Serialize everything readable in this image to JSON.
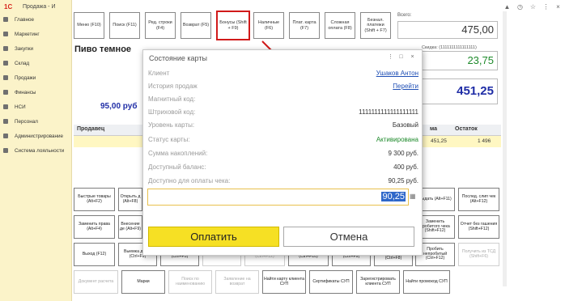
{
  "app": {
    "logo": "1С",
    "title": "Продажа - И"
  },
  "sidebar": {
    "items": [
      {
        "label": "Главное"
      },
      {
        "label": "Маркетинг"
      },
      {
        "label": "Закупки"
      },
      {
        "label": "Склад"
      },
      {
        "label": "Продажи"
      },
      {
        "label": "Финансы"
      },
      {
        "label": "НСИ"
      },
      {
        "label": "Персонал"
      },
      {
        "label": "Администрирование"
      },
      {
        "label": "Система лояльности"
      }
    ]
  },
  "toolbar": {
    "menu": "Меню (F10)",
    "search": "Поиск (F11)",
    "edit_line": "Ред. строки (F4)",
    "return": "Возврат (F5)",
    "bonuses": "Бонусы (Shift + F9)",
    "cash": "Наличные (F6)",
    "card": "Плат. карта (F7)",
    "complex": "Сложная оплата (F8)",
    "cashless": "Безнал. платежи (Shift + F7)"
  },
  "totals": {
    "total_label": "Всего:",
    "total_value": "475,00",
    "discount_label": "Скидка: (1111111111111111)",
    "discount_value": "23,75",
    "to_pay_value": "451,25"
  },
  "product": {
    "name": "Пиво темное",
    "price": "95,00 руб"
  },
  "table": {
    "headers": {
      "seller": "Продавец",
      "sum": "ма",
      "stock": "Остаток"
    },
    "row": {
      "sum": "451,25",
      "stock": "1 496"
    }
  },
  "grid": {
    "row1": [
      "Быстрые товары (Alt+F2)",
      "Открыть д (Alt+F8)",
      "",
      "",
      "",
      "",
      "",
      "",
      "Выдать (Alt+F11)",
      "Послед. слип чек (Alt+F12)"
    ],
    "row2": [
      "Заменить права (Alt+F4)",
      "Внесение де (Alt+F9)",
      "",
      "",
      "",
      "",
      "",
      "",
      "Заменить пробитого чека (Shift+F12)",
      "Отчет без гашения (Shift+F12)"
    ],
    "row3": [
      "Выход (F12)",
      "Выемка денег (Ctrl+F9)",
      "Продолж. чек (Ctrl+F5)",
      "Ввод серий",
      "Получить вес (Ctrl+F12)",
      "Выбор продавца (Ctrl+F10)",
      "Управл. скидки (Ctrl+F9)",
      "Активировать сертификаты (Ctrl+F8)",
      "Пробить непробитый (Ctrl+F12)",
      "Получить из ТСД (Shift+F6)"
    ],
    "row4": [
      "Документ расчета",
      "Марки",
      "Поиск по наименованию",
      "Заявление на возврат",
      "Найти карту клиента СУП",
      "Сертификаты СУП",
      "Зарегистрировать клиента СУП",
      "Найти промокод СУП"
    ]
  },
  "dialog": {
    "title": "Состояние карты",
    "rows": [
      {
        "label": "Клиент",
        "value": "Ушаков Антон",
        "style": "link"
      },
      {
        "label": "История продаж",
        "value": "Перейти",
        "style": "link"
      },
      {
        "label": "Магнитный код:",
        "value": "",
        "style": "plain"
      },
      {
        "label": "Штриховой код:",
        "value": "1111111111111111111",
        "style": "plain"
      },
      {
        "label": "Уровень карты:",
        "value": "Базовый",
        "style": "plain"
      },
      {
        "label": "Статус карты:",
        "value": "Активирована",
        "style": "green"
      },
      {
        "label": "Сумма накоплений:",
        "value": "9 300  руб.",
        "style": "plain"
      },
      {
        "label": "Доступный баланс:",
        "value": "400  руб.",
        "style": "plain"
      },
      {
        "label": "Доступно для оплаты чека:",
        "value": "90,25  руб.",
        "style": "plain"
      }
    ],
    "amount": "90,25",
    "pay_label": "Оплатить",
    "cancel_label": "Отмена"
  },
  "colors": {
    "highlight_frame": "#d11a1a",
    "pay_button": "#f6e024",
    "status_active": "#1e8a2b",
    "link": "#1f4fb5",
    "price_blue": "#1f2da6"
  }
}
